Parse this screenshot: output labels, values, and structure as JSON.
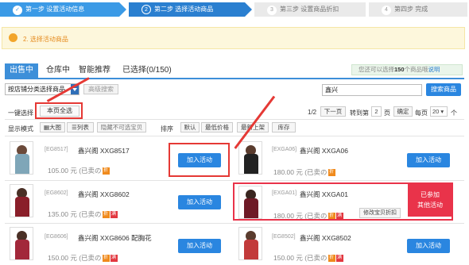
{
  "steps": [
    {
      "num": "1",
      "label": "第一步 设置活动信息",
      "state": "done"
    },
    {
      "num": "2",
      "label": "第二步 选择活动商品",
      "state": "current"
    },
    {
      "num": "3",
      "label": "第三步 设置商品折扣",
      "state": "todo"
    },
    {
      "num": "4",
      "label": "第四步 完成",
      "state": "todo"
    }
  ],
  "notice": "2. 选择活动商品",
  "tabs": [
    {
      "label": "出售中",
      "active": true
    },
    {
      "label": "仓库中",
      "active": false
    },
    {
      "label": "智能推荐",
      "active": false
    },
    {
      "label": "已选择(0/150)",
      "active": false
    }
  ],
  "quota": {
    "prefix": "您还可以选择",
    "count": "150",
    "suffix": "个商品哦",
    "link": "说明"
  },
  "filter": {
    "category_select": "按店铺分类选择商品",
    "advanced_btn": "高级搜索",
    "search_value": "鑫兴",
    "search_btn": "搜索商品"
  },
  "bulk": {
    "label": "一键选择",
    "select_page": "本页全选"
  },
  "pager": {
    "page": "1/2",
    "next": "下一页",
    "goto_prefix": "转到第",
    "goto_value": "2",
    "goto_suffix": "页",
    "confirm": "确定",
    "per_page_label": "每页",
    "per_page_value": "20",
    "per_page_suffix": "个"
  },
  "display": {
    "label": "显示模式",
    "large": "大图",
    "list": "列表",
    "hide_unavailable": "隐藏不可选宝贝"
  },
  "sort": {
    "label": "排序",
    "options": [
      "默认",
      "最低价格",
      "最新上架",
      "库存"
    ]
  },
  "products": [
    {
      "code": "[EG8517]",
      "name": "鑫兴阁 XXG8517",
      "price": "105.00 元 (已卖の",
      "badges": [
        "折"
      ],
      "action": "加入活动"
    },
    {
      "code": "[EXGA06]",
      "name": "鑫兴阁 XXGA06",
      "price": "180.00 元 (已卖の",
      "badges": [
        "折"
      ],
      "action": "加入活动"
    },
    {
      "code": "[EG8602]",
      "name": "鑫兴阁 XXG8602",
      "price": "135.00 元 (已卖の",
      "badges": [
        "折",
        "满"
      ],
      "action": "加入活动"
    },
    {
      "code": "[EXGA01]",
      "name": "鑫兴阁 XXGA01",
      "price": "180.00 元 (已卖の",
      "badges": [
        "折",
        "满"
      ],
      "action": "已参加\n其他活动",
      "extra": "修改宝贝折扣"
    },
    {
      "code": "[EG8606]",
      "name": "鑫兴阁 XXG8606 配胸花",
      "price": "150.00 元 (已卖の",
      "badges": [
        "折",
        "满"
      ],
      "action": "加入活动"
    },
    {
      "code": "[EG8502]",
      "name": "鑫兴阁 XXG8502",
      "price": "150.00 元 (已卖の",
      "badges": [
        "折",
        "满"
      ],
      "action": "加入活动"
    }
  ],
  "colors": {
    "primary": "#2a86e0",
    "highlight": "#e53935",
    "joined": "#e9334a"
  }
}
